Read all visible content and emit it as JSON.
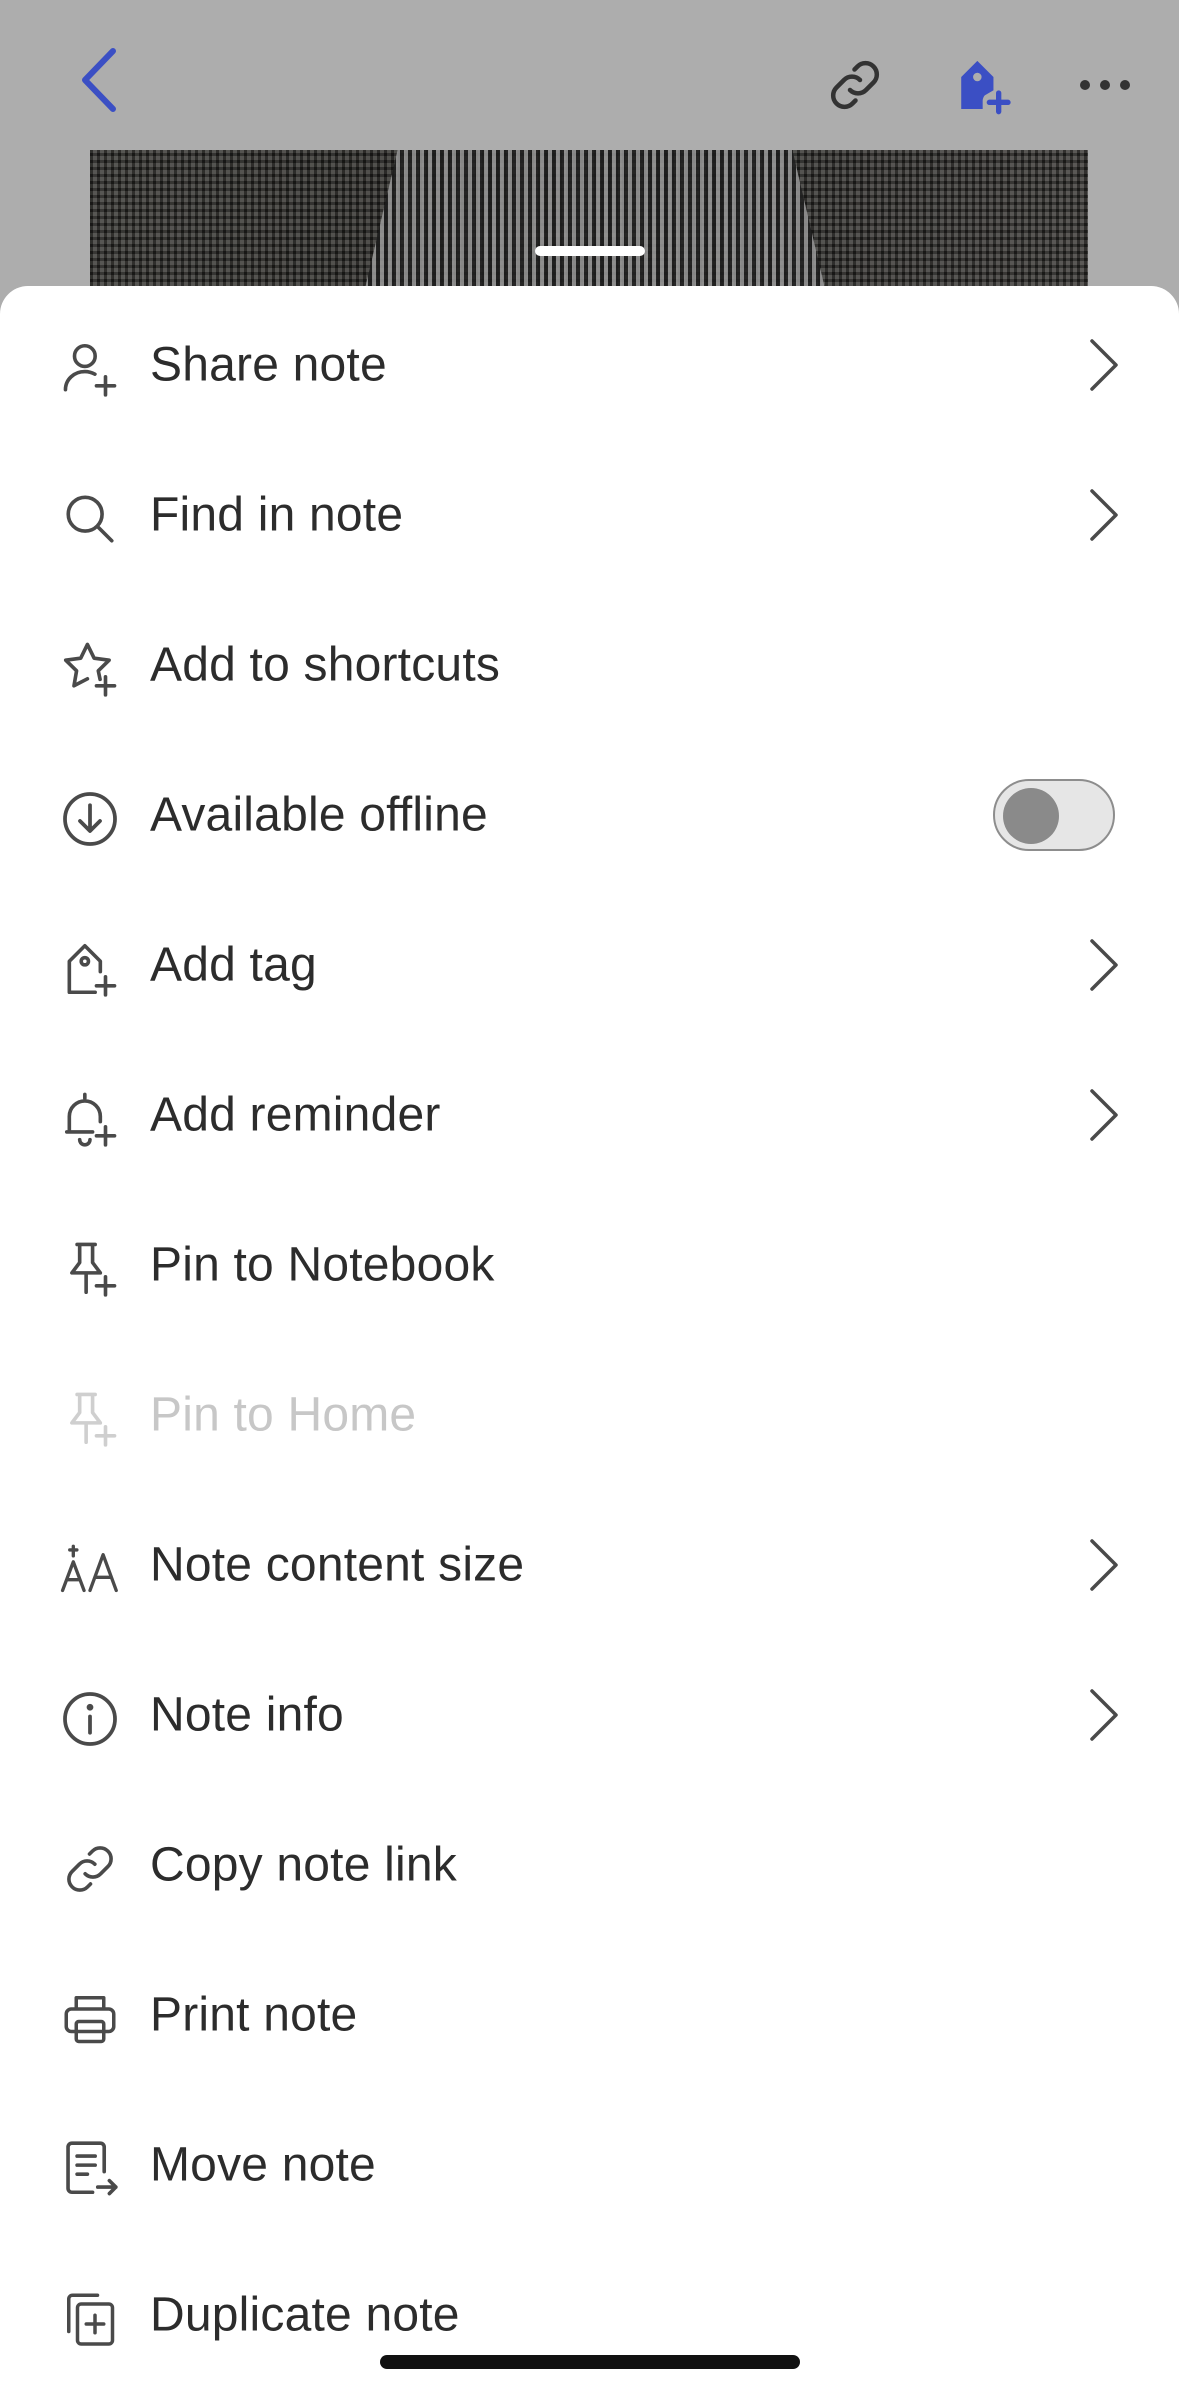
{
  "header": {
    "back_icon": "chevron-left-icon",
    "link_icon": "link-icon",
    "tag_icon": "tag-plus-icon",
    "more_icon": "more-horizontal-icon",
    "accent_color": "#3b4fc4"
  },
  "menu": {
    "items": [
      {
        "label": "Share note",
        "icon": "person-plus-icon",
        "chevron": true
      },
      {
        "label": "Find in note",
        "icon": "search-icon",
        "chevron": true
      },
      {
        "label": "Add to shortcuts",
        "icon": "star-plus-icon",
        "chevron": false
      },
      {
        "label": "Available offline",
        "icon": "download-circle-icon",
        "toggle": false
      },
      {
        "label": "Add tag",
        "icon": "tag-plus-icon",
        "chevron": true
      },
      {
        "label": "Add reminder",
        "icon": "bell-plus-icon",
        "chevron": true
      },
      {
        "label": "Pin to Notebook",
        "icon": "pin-plus-icon",
        "chevron": false
      },
      {
        "label": "Pin to Home",
        "icon": "pin-plus-icon",
        "chevron": false,
        "disabled": true
      },
      {
        "label": "Note content size",
        "icon": "text-size-icon",
        "chevron": true
      },
      {
        "label": "Note info",
        "icon": "info-icon",
        "chevron": true
      },
      {
        "label": "Copy note link",
        "icon": "link-icon",
        "chevron": false
      },
      {
        "label": "Print note",
        "icon": "printer-icon",
        "chevron": false
      },
      {
        "label": "Move note",
        "icon": "move-note-icon",
        "chevron": false
      },
      {
        "label": "Duplicate note",
        "icon": "duplicate-icon",
        "chevron": false
      }
    ]
  },
  "colors": {
    "text": "#2c2c2c",
    "disabled_text": "#c7c7c7",
    "icon": "#4a4a4a"
  }
}
